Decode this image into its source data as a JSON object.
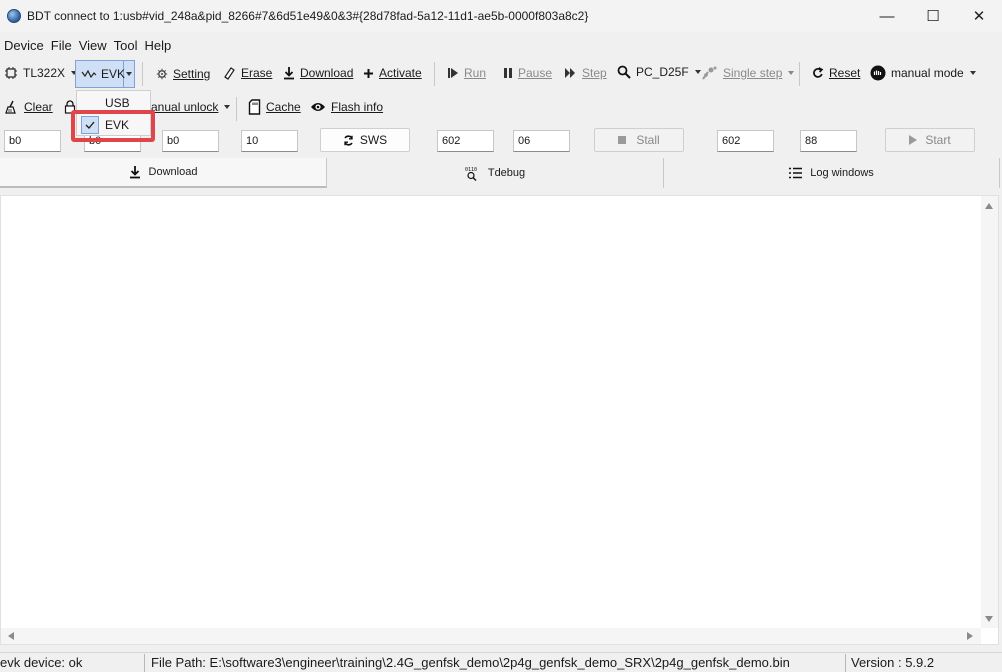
{
  "window": {
    "title": "BDT connect to 1:usb#vid_248a&pid_8266#7&6d51e49&0&3#{28d78fad-5a12-11d1-ae5b-0000f803a8c2}",
    "minimize": "—",
    "maximize": "☐",
    "close": "✕"
  },
  "menubar": [
    "Device",
    "File",
    "View",
    "Tool",
    "Help"
  ],
  "toolbar1": {
    "chip": "TL322X",
    "interface": "EVK",
    "setting": "Setting",
    "erase": "Erase",
    "download": "Download",
    "activate": "Activate",
    "run": "Run",
    "pause": "Pause",
    "step": "Step",
    "pc_select": "PC_D25F",
    "single_step": "Single step",
    "reset": "Reset",
    "mode": "manual mode"
  },
  "interface_menu": {
    "options": [
      "USB",
      "EVK"
    ],
    "selected": "EVK"
  },
  "toolbar2": {
    "clear": "Clear",
    "manual_unlock": "Manual unlock",
    "manual_unlock_visible": "anual unlock",
    "cache": "Cache",
    "flash_info": "Flash info"
  },
  "fields": {
    "f1": "b0",
    "f2": "b0",
    "f3": "b0",
    "f4": "10",
    "sws_button": "SWS",
    "f5": "602",
    "f6": "06",
    "stall_button": "Stall",
    "f7": "602",
    "f8": "88",
    "start_button": "Start"
  },
  "tabs": [
    "Download",
    "Tdebug",
    "Log windows"
  ],
  "statusbar": {
    "device": "evk device: ok",
    "file_path": "File Path:  E:\\software3\\engineer\\training\\2.4G_genfsk_demo\\2p4g_genfsk_demo_SRX\\2p4g_genfsk_demo.bin",
    "version": "Version : 5.9.2"
  },
  "colors": {
    "highlight": "#e0454a",
    "selected_bg": "#cfe0f6"
  }
}
